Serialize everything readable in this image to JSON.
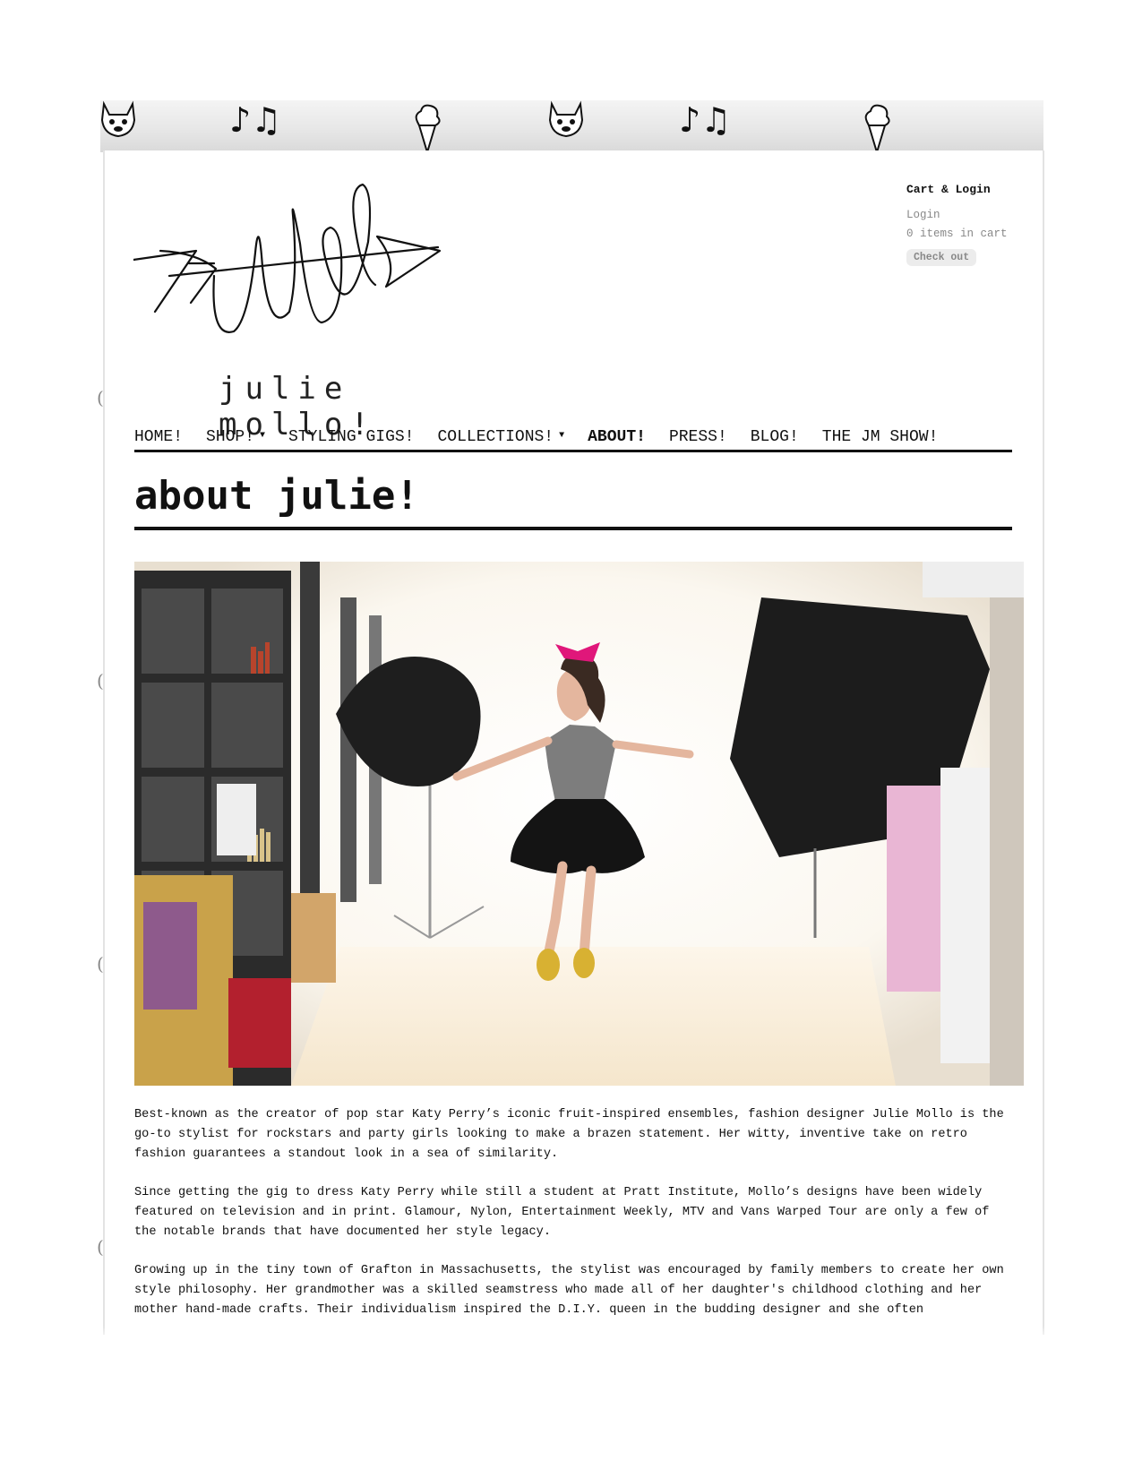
{
  "header": {
    "logo_text": "julie mollo!"
  },
  "cart": {
    "title": "Cart & Login",
    "login_label": "Login",
    "items_label": "0 items in cart",
    "checkout_label": "Check out"
  },
  "nav": {
    "items": [
      {
        "label": "HOME!",
        "has_dropdown": false
      },
      {
        "label": "SHOP!",
        "has_dropdown": true
      },
      {
        "label": "STYLING GIGS!",
        "has_dropdown": false
      },
      {
        "label": "COLLECTIONS!",
        "has_dropdown": true
      },
      {
        "label": "ABOUT!",
        "has_dropdown": false,
        "active": true
      },
      {
        "label": "PRESS!",
        "has_dropdown": false
      },
      {
        "label": "BLOG!",
        "has_dropdown": false
      },
      {
        "label": "THE JM SHOW!",
        "has_dropdown": false
      }
    ]
  },
  "main": {
    "title": "about julie!",
    "paragraphs": [
      "Best-known as the creator of pop star Katy Perry’s iconic fruit-inspired ensembles, fashion designer Julie Mollo is the go-to stylist for rockstars and party girls looking to make a brazen statement. Her witty, inventive take on retro fashion guarantees a standout look in a sea of similarity.",
      "Since getting the gig to dress Katy Perry while still a student at Pratt Institute, Mollo’s designs have been widely featured on television and in print. Glamour, Nylon, Entertainment Weekly, MTV and Vans Warped Tour are only a few of the notable brands that have documented her style legacy.",
      "Growing up in the tiny town of Grafton in Massachusetts, the stylist was encouraged by family members to create her own style philosophy. Her grandmother was a skilled seamstress who made all of her daughter's childhood clothing and her mother hand-made crafts. Their individualism inspired the D.I.Y. queen in the budding designer and she often"
    ]
  },
  "colors": {
    "accent": "#e0177a",
    "text": "#111111",
    "muted": "#888888"
  }
}
